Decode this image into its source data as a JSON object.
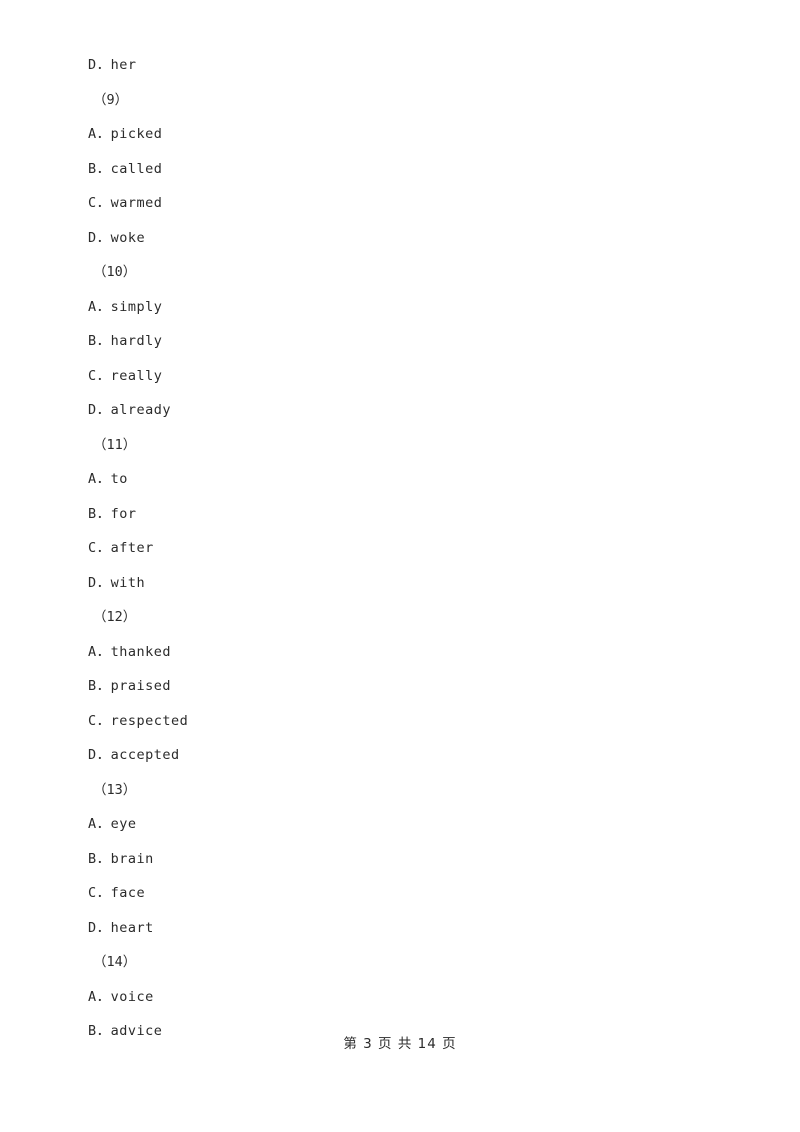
{
  "document": {
    "type": "exam-worksheet",
    "language": "en-zh",
    "text_color": "#2b2b2b",
    "background_color": "#ffffff"
  },
  "lines": [
    {
      "kind": "option",
      "text": "D．her"
    },
    {
      "kind": "qnum",
      "text": "（9）"
    },
    {
      "kind": "option",
      "text": "A．picked"
    },
    {
      "kind": "option",
      "text": "B．called"
    },
    {
      "kind": "option",
      "text": "C．warmed"
    },
    {
      "kind": "option",
      "text": "D．woke"
    },
    {
      "kind": "qnum",
      "text": "（10）"
    },
    {
      "kind": "option",
      "text": "A．simply"
    },
    {
      "kind": "option",
      "text": "B．hardly"
    },
    {
      "kind": "option",
      "text": "C．really"
    },
    {
      "kind": "option",
      "text": "D．already"
    },
    {
      "kind": "qnum",
      "text": "（11）"
    },
    {
      "kind": "option",
      "text": "A．to"
    },
    {
      "kind": "option",
      "text": "B．for"
    },
    {
      "kind": "option",
      "text": "C．after"
    },
    {
      "kind": "option",
      "text": "D．with"
    },
    {
      "kind": "qnum",
      "text": "（12）"
    },
    {
      "kind": "option",
      "text": "A．thanked"
    },
    {
      "kind": "option",
      "text": "B．praised"
    },
    {
      "kind": "option",
      "text": "C．respected"
    },
    {
      "kind": "option",
      "text": "D．accepted"
    },
    {
      "kind": "qnum",
      "text": "（13）"
    },
    {
      "kind": "option",
      "text": "A．eye"
    },
    {
      "kind": "option",
      "text": "B．brain"
    },
    {
      "kind": "option",
      "text": "C．face"
    },
    {
      "kind": "option",
      "text": "D．heart"
    },
    {
      "kind": "qnum",
      "text": "（14）"
    },
    {
      "kind": "option",
      "text": "A．voice"
    },
    {
      "kind": "option",
      "text": "B．advice"
    }
  ],
  "footer": {
    "text": "第 3 页 共 14 页",
    "current_page": "3",
    "total_pages": "14"
  }
}
